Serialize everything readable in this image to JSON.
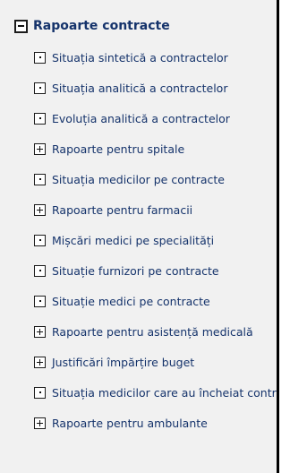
{
  "tree": {
    "root": {
      "label": "Rapoarte contracte",
      "expanded": true
    },
    "items": [
      {
        "label": "Situația sintetică a contractelor",
        "type": "leaf"
      },
      {
        "label": "Situația analitică a contractelor",
        "type": "leaf"
      },
      {
        "label": "Evoluția analitică a contractelor",
        "type": "leaf"
      },
      {
        "label": "Rapoarte pentru spitale",
        "type": "folder"
      },
      {
        "label": "Situația medicilor pe contracte",
        "type": "leaf"
      },
      {
        "label": "Rapoarte pentru farmacii",
        "type": "folder"
      },
      {
        "label": "Mișcări medici pe specialități",
        "type": "leaf"
      },
      {
        "label": "Situație furnizori pe contracte",
        "type": "leaf"
      },
      {
        "label": "Situație medici pe contracte",
        "type": "leaf"
      },
      {
        "label": "Rapoarte pentru asistență medicală",
        "type": "folder"
      },
      {
        "label": "Justificări împărțire buget",
        "type": "folder"
      },
      {
        "label": "Situația medicilor care au încheiat contracte",
        "type": "leaf"
      },
      {
        "label": "Rapoarte pentru ambulante",
        "type": "folder"
      }
    ]
  }
}
